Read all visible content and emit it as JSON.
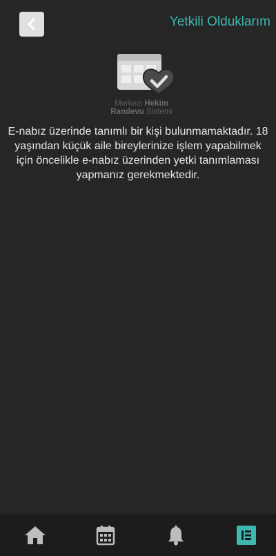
{
  "header": {
    "back_icon": "chevron-left-icon",
    "title": "Yetkili Olduklarım"
  },
  "logo": {
    "line1_light": "Merkezi",
    "line1_bold": "Hekim",
    "line2_bold": "Randevu",
    "line2_light": "Sistemi"
  },
  "main": {
    "message": "E-nabız üzerinde tanımlı bir kişi bulunmamaktadır. 18 yaşından küçük aile bireylerinize işlem yapabilmek için öncelikle e-nabız üzerinden yetki tanımlaması yapmanız gerekmektedir."
  },
  "bottom_nav": {
    "items": [
      {
        "icon": "home-icon",
        "active": false
      },
      {
        "icon": "calendar-icon",
        "active": false
      },
      {
        "icon": "bell-icon",
        "active": false
      },
      {
        "icon": "list-icon",
        "active": true
      }
    ],
    "active_color": "#3cb8b0",
    "inactive_color": "#bdbdbd"
  }
}
